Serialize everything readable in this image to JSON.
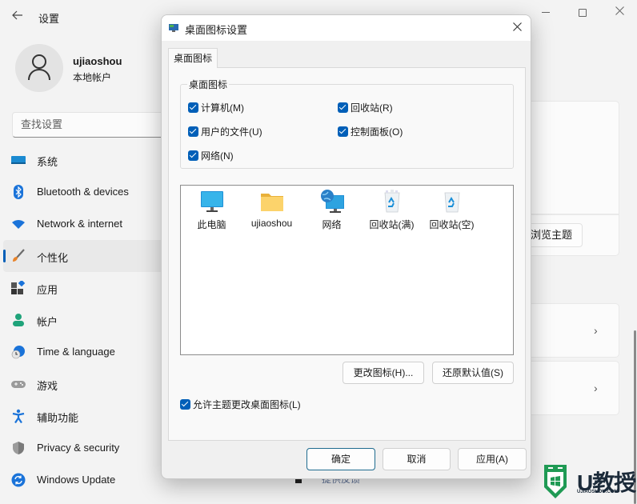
{
  "settings": {
    "app_title": "设置",
    "window_controls": {
      "minimize": "minimize",
      "maximize": "maximize",
      "close": "close"
    },
    "profile": {
      "name": "ujiaoshou",
      "account_type": "本地帐户"
    },
    "search": {
      "placeholder": "查找设置"
    },
    "nav": [
      {
        "label": "系统",
        "icon": "system-icon",
        "active": false
      },
      {
        "label": "Bluetooth & devices",
        "icon": "bluetooth-icon",
        "active": false
      },
      {
        "label": "Network & internet",
        "icon": "wifi-icon",
        "active": false
      },
      {
        "label": "个性化",
        "icon": "brush-icon",
        "active": true
      },
      {
        "label": "应用",
        "icon": "apps-icon",
        "active": false
      },
      {
        "label": "帐户",
        "icon": "person-icon",
        "active": false
      },
      {
        "label": "Time & language",
        "icon": "clock-globe-icon",
        "active": false
      },
      {
        "label": "游戏",
        "icon": "gamepad-icon",
        "active": false
      },
      {
        "label": "辅助功能",
        "icon": "accessibility-icon",
        "active": false
      },
      {
        "label": "Privacy & security",
        "icon": "shield-icon",
        "active": false
      },
      {
        "label": "Windows Update",
        "icon": "update-icon",
        "active": false
      }
    ],
    "content": {
      "browse_themes_label": "浏览主题",
      "bottom_link": "提供反馈"
    }
  },
  "dialog": {
    "title": "桌面图标设置",
    "tab_label": "桌面图标",
    "group_label": "桌面图标",
    "checkboxes": [
      {
        "label": "计算机(M)",
        "checked": true
      },
      {
        "label": "回收站(R)",
        "checked": true
      },
      {
        "label": "用户的文件(U)",
        "checked": true
      },
      {
        "label": "控制面板(O)",
        "checked": true
      },
      {
        "label": "网络(N)",
        "checked": true
      }
    ],
    "icons": [
      {
        "caption": "此电脑",
        "icon": "monitor-icon"
      },
      {
        "caption": "ujiaoshou",
        "icon": "folder-icon"
      },
      {
        "caption": "网络",
        "icon": "network-icon"
      },
      {
        "caption": "回收站(满)",
        "icon": "recycle-bin-full-icon"
      },
      {
        "caption": "回收站(空)",
        "icon": "recycle-bin-empty-icon"
      }
    ],
    "change_icon_label": "更改图标(H)...",
    "restore_default_label": "还原默认值(S)",
    "allow_themes": {
      "label": "允许主题更改桌面图标(L)",
      "checked": true
    },
    "ok_label": "确定",
    "cancel_label": "取消",
    "apply_label": "应用(A)"
  },
  "watermark": {
    "text": "U教授",
    "sub": "UJIAOSHOU.COM"
  },
  "colors": {
    "accent": "#005fb8",
    "watermark_green": "#1f9a54"
  }
}
